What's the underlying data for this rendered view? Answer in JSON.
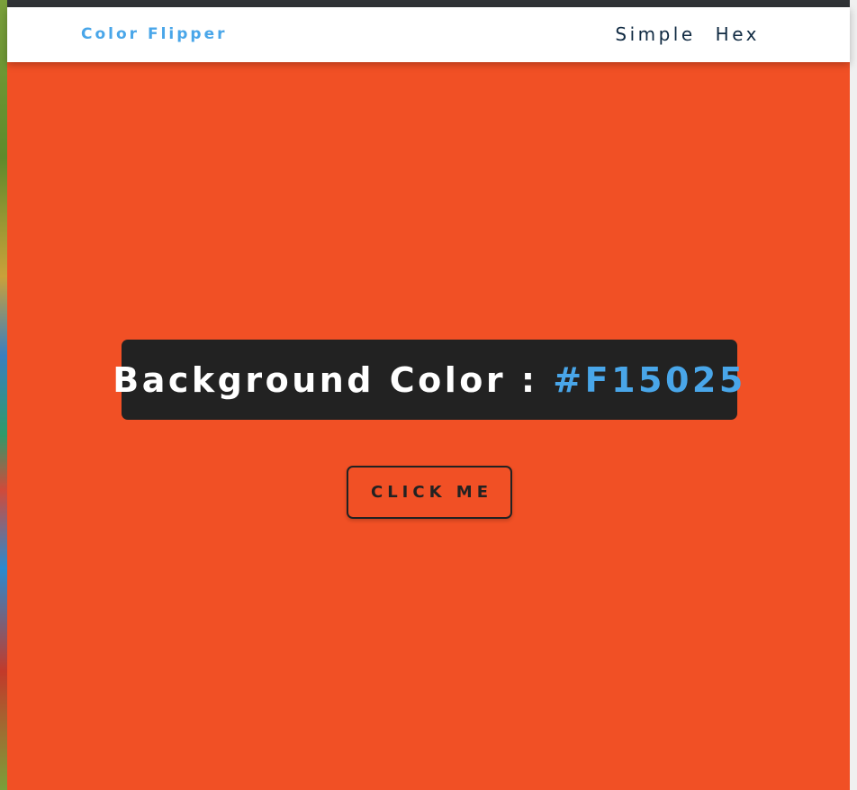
{
  "navbar": {
    "brand": "Color Flipper",
    "links": [
      "Simple",
      "Hex"
    ]
  },
  "main": {
    "label": "Background Color : ",
    "color_value": "#F15025",
    "button_label": "CLICK ME"
  },
  "colors": {
    "background": "#f15025",
    "accent": "#49a6e9",
    "box": "#222222",
    "nav_text": "#102a42"
  }
}
